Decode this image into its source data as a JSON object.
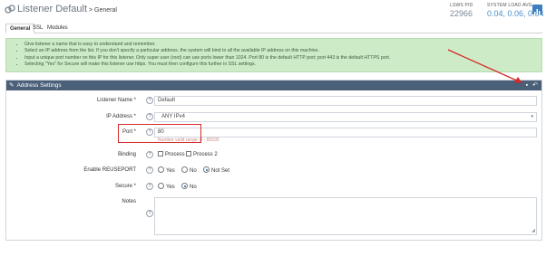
{
  "header": {
    "title": "Listener Default",
    "crumb": " > General",
    "live_pid_label": "LSWS PID",
    "live_pid_value": "22966",
    "load_label": "SYSTEM LOAD AVG.",
    "load_value": "0.04, 0.06, 0.04"
  },
  "tabs": [
    {
      "label": "General"
    },
    {
      "label": "SSL"
    },
    {
      "label": "Modules"
    }
  ],
  "info": [
    "Give listener a name that is easy to understand and remember.",
    "Select an IP address from the list. If you don't specify a particular address, the system will bind to all the available IP address on this machine.",
    "Input a unique port number on this IP for this listener. Only super user (root) can use ports lower than 1024. Port 80 is the default HTTP port; port 443 is the default HTTPS port.",
    "Selecting \"Yes\" for Secure will make this listener use https. You must then configure this further in SSL settings."
  ],
  "panel": {
    "title": "Address Settings",
    "fields": {
      "name_label": "Listener Name *",
      "name_value": "Default",
      "ip_label": "IP Address *",
      "ip_value": "ANY IPv4",
      "port_label": "Port *",
      "port_value": "80",
      "port_hint": "Number valid range: 0 - 65535",
      "binding_label": "Binding",
      "binding_opt1": "Process 1",
      "binding_opt2": "Process 2",
      "reuse_label": "Enable REUSEPORT",
      "reuse_yes": "Yes",
      "reuse_no": "No",
      "reuse_notset": "Not Set",
      "secure_label": "Secure *",
      "secure_yes": "Yes",
      "secure_no": "No",
      "notes_label": "Notes"
    }
  },
  "icons": {
    "title_icon": "link-icon",
    "save_icon": "save-icon",
    "back_icon": "undo-icon"
  }
}
